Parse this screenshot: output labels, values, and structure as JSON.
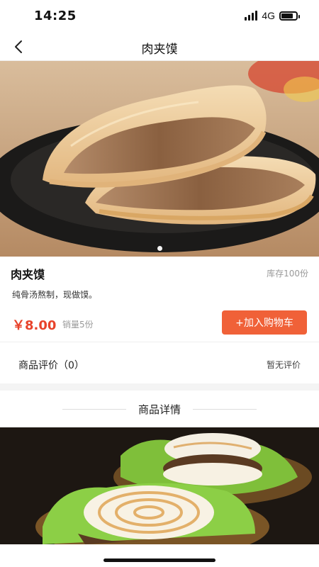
{
  "status_bar": {
    "time": "14:25",
    "network": "4G",
    "signal_bars": 4,
    "battery_level": 0.8
  },
  "nav": {
    "title": "肉夹馍",
    "back_icon": "chevron-left-icon"
  },
  "hero": {
    "carousel_total": 1,
    "carousel_active": 1
  },
  "product": {
    "name": "肉夹馍",
    "stock": "库存100份",
    "description": "纯骨汤熬制，现做馍。",
    "price": "￥8.00",
    "sales": "销量5份",
    "add_to_cart": "+加入购物车"
  },
  "review": {
    "title": "商品评价（0）",
    "status": "暂无评价"
  },
  "details": {
    "title": "商品详情"
  },
  "colors": {
    "accent": "#f06138",
    "price": "#e8432b"
  }
}
